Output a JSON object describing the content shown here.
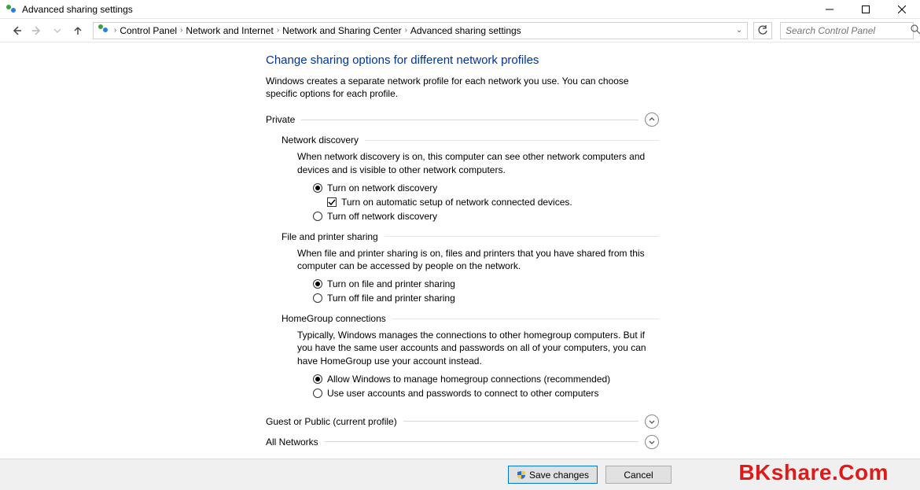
{
  "window": {
    "title": "Advanced sharing settings"
  },
  "breadcrumbs": {
    "items": [
      "Control Panel",
      "Network and Internet",
      "Network and Sharing Center",
      "Advanced sharing settings"
    ]
  },
  "search": {
    "placeholder": "Search Control Panel"
  },
  "page": {
    "title": "Change sharing options for different network profiles",
    "desc": "Windows creates a separate network profile for each network you use. You can choose specific options for each profile."
  },
  "private": {
    "label": "Private",
    "network_discovery": {
      "title": "Network discovery",
      "desc": "When network discovery is on, this computer can see other network computers and devices and is visible to other network computers.",
      "opt_on": "Turn on network discovery",
      "opt_auto": "Turn on automatic setup of network connected devices.",
      "opt_off": "Turn off network discovery"
    },
    "file_printer": {
      "title": "File and printer sharing",
      "desc": "When file and printer sharing is on, files and printers that you have shared from this computer can be accessed by people on the network.",
      "opt_on": "Turn on file and printer sharing",
      "opt_off": "Turn off file and printer sharing"
    },
    "homegroup": {
      "title": "HomeGroup connections",
      "desc": "Typically, Windows manages the connections to other homegroup computers. But if you have the same user accounts and passwords on all of your computers, you can have HomeGroup use your account instead.",
      "opt_allow": "Allow Windows to manage homegroup connections (recommended)",
      "opt_user": "Use user accounts and passwords to connect to other computers"
    }
  },
  "guest": {
    "label": "Guest or Public (current profile)"
  },
  "all": {
    "label": "All Networks"
  },
  "footer": {
    "save": "Save changes",
    "cancel": "Cancel"
  },
  "watermark": "BKshare.Com"
}
